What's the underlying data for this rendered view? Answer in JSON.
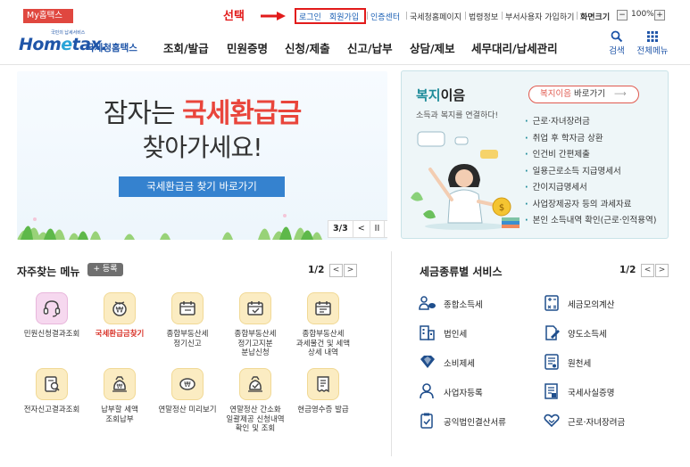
{
  "topbar": {
    "my_hometax": "My홈택스",
    "annotation": "선택",
    "login": "로그인",
    "signup": "회원가입",
    "cert_center": "인증센터",
    "nts_page": "국세청홈페이지",
    "law_info": "법령정보",
    "dept_user": "부서사용자 가입하기",
    "screen_size": "화면크기",
    "zoom_minus": "−",
    "zoom_value": "100%",
    "zoom_plus": "+"
  },
  "header": {
    "logo_sub": "국민의 납세서비스",
    "logo_ho": "Hom",
    "logo_e": "e",
    "logo_tax": "tax.",
    "logo_name": "국세청홈택스",
    "nav": [
      "조회/발급",
      "민원증명",
      "신청/제출",
      "신고/납부",
      "상담/제보",
      "세무대리/납세관리"
    ],
    "search": "검색",
    "all_menu": "전체메뉴"
  },
  "banner": {
    "line1_pre": "잠자는 ",
    "line1_hl": "국세환급금",
    "line2": "찾아가세요!",
    "button": "국세환급금 찾기 바로가기",
    "page": "3/3",
    "prev": "<",
    "pause": "II",
    "next": ">"
  },
  "welfare": {
    "title_hl": "복지",
    "title_rest": "이음",
    "btn_hl": "복지이음",
    "btn_rest": " 바로가기",
    "subtitle": "소득과 복지를 연결하다!",
    "items": [
      "근로·자녀장려금",
      "취업 후 학자금 상환",
      "인건비 간편제출",
      "일용근로소득 지급명세서",
      "간이지급명세서",
      "사업장제공자 등의 과세자료",
      "본인 소득내역 확인(근로·인적용역)"
    ]
  },
  "frequent": {
    "title": "자주찾는 메뉴",
    "register": "+ 등록",
    "page": "1/2",
    "prev": "<",
    "next": ">",
    "items": [
      {
        "label": "민원신청결과조회",
        "icon": "headset-icon"
      },
      {
        "label": "국세환급금찾기",
        "icon": "refund-icon"
      },
      {
        "label": "종합부동산세\n정기신고",
        "icon": "calendar-icon"
      },
      {
        "label": "종합부동산세\n정기고지분\n분납신청",
        "icon": "calendar-check-icon"
      },
      {
        "label": "종합부동산세\n과세물건 및 세액\n상세 내역",
        "icon": "calendar-search-icon"
      },
      {
        "label": "전자신고결과조회",
        "icon": "document-search-icon"
      },
      {
        "label": "납부할 세액\n조회납부",
        "icon": "money-bag-icon"
      },
      {
        "label": "연말정산 미리보기",
        "icon": "coin-icon"
      },
      {
        "label": "연말정산 간소화\n일괄제공 신청내역\n확인 및 조회",
        "icon": "money-bag-check-icon"
      },
      {
        "label": "현금영수증 발급",
        "icon": "receipt-icon"
      }
    ]
  },
  "tax_services": {
    "title": "세금종류별 서비스",
    "page": "1/2",
    "prev": "<",
    "next": ">",
    "left": [
      {
        "label": "종합소득세",
        "icon": "person-money-icon"
      },
      {
        "label": "법인세",
        "icon": "building-icon"
      },
      {
        "label": "소비제세",
        "icon": "diamond-icon"
      },
      {
        "label": "사업자등록",
        "icon": "user-icon"
      },
      {
        "label": "공익법인결산서류",
        "icon": "clipboard-icon"
      }
    ],
    "right": [
      {
        "label": "세금모의계산",
        "icon": "calculator-icon"
      },
      {
        "label": "양도소득세",
        "icon": "edit-document-icon"
      },
      {
        "label": "원천세",
        "icon": "tax-form-icon"
      },
      {
        "label": "국세사실증명",
        "icon": "certificate-icon"
      },
      {
        "label": "근로·자녀장려금",
        "icon": "heart-hand-icon"
      }
    ]
  }
}
